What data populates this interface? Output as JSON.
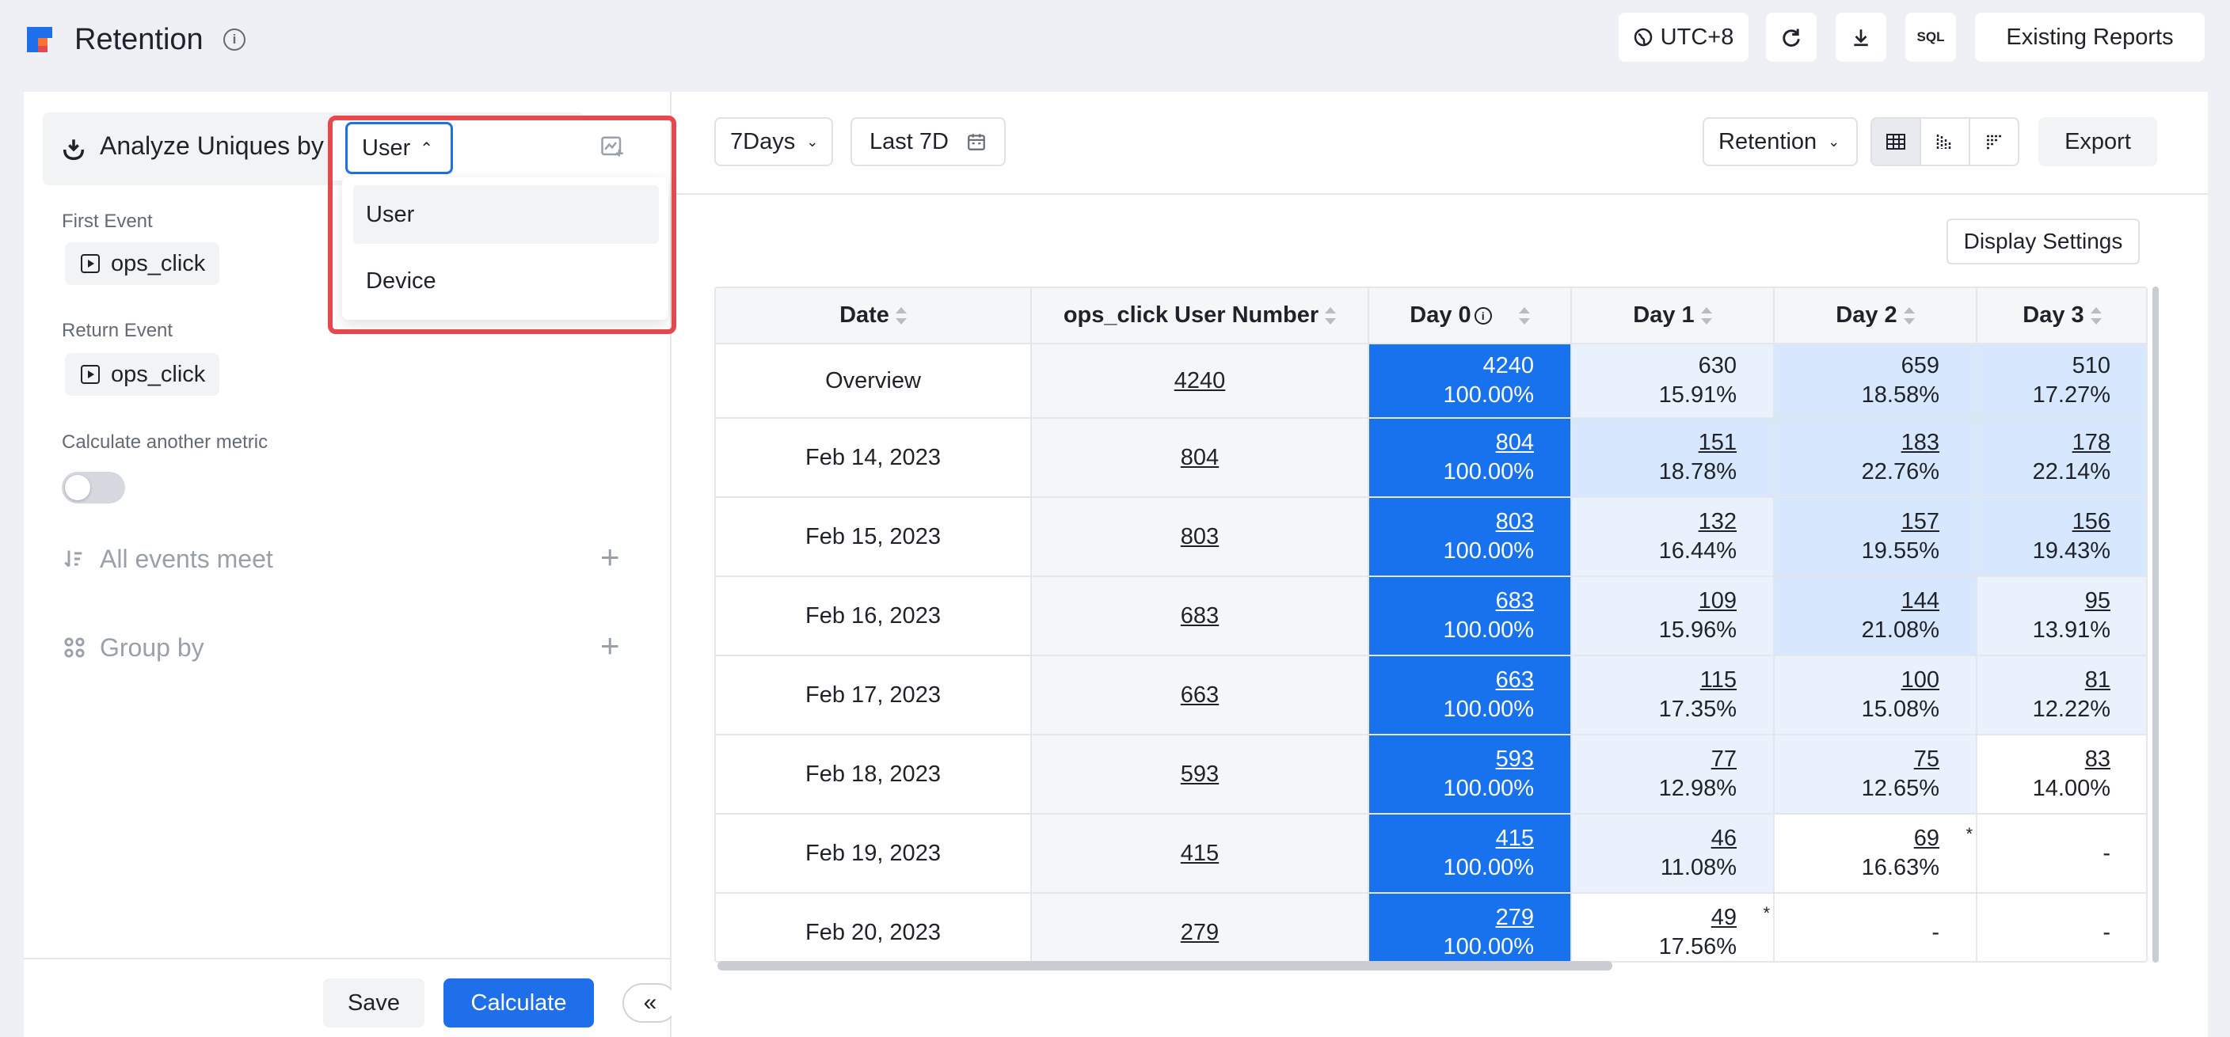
{
  "header": {
    "title": "Retention",
    "timezone": "UTC+8",
    "sql_label": "SQL",
    "existing_reports": "Existing Reports"
  },
  "left": {
    "analyze_label": "Analyze Uniques by",
    "selected_unit": "User",
    "unit_options": [
      "User",
      "Device"
    ],
    "first_event_label": "First Event",
    "first_event": "ops_click",
    "return_event_label": "Return Event",
    "return_event": "ops_click",
    "another_metric_label": "Calculate another metric",
    "another_metric_on": false,
    "all_events_label": "All events meet",
    "group_by_label": "Group by",
    "save": "Save",
    "calculate": "Calculate"
  },
  "toolbar": {
    "interval": "7Days",
    "range": "Last 7D",
    "metric": "Retention",
    "export": "Export",
    "display_settings": "Display Settings"
  },
  "table": {
    "headers": [
      "Date",
      "ops_click User Number",
      "Day 0",
      "Day 1",
      "Day 2",
      "Day 3"
    ],
    "rows": [
      {
        "date": "Overview",
        "num": "4240",
        "d0": [
          "4240",
          "100.00%"
        ],
        "d1": [
          "630",
          "15.91%"
        ],
        "d2": [
          "659",
          "18.58%"
        ],
        "d3": [
          "510",
          "17.27%"
        ]
      },
      {
        "date": "Feb 14, 2023",
        "num": "804",
        "d0": [
          "804",
          "100.00%"
        ],
        "d1": [
          "151",
          "18.78%"
        ],
        "d2": [
          "183",
          "22.76%"
        ],
        "d3": [
          "178",
          "22.14%"
        ]
      },
      {
        "date": "Feb 15, 2023",
        "num": "803",
        "d0": [
          "803",
          "100.00%"
        ],
        "d1": [
          "132",
          "16.44%"
        ],
        "d2": [
          "157",
          "19.55%"
        ],
        "d3": [
          "156",
          "19.43%"
        ]
      },
      {
        "date": "Feb 16, 2023",
        "num": "683",
        "d0": [
          "683",
          "100.00%"
        ],
        "d1": [
          "109",
          "15.96%"
        ],
        "d2": [
          "144",
          "21.08%"
        ],
        "d3": [
          "95",
          "13.91%"
        ]
      },
      {
        "date": "Feb 17, 2023",
        "num": "663",
        "d0": [
          "663",
          "100.00%"
        ],
        "d1": [
          "115",
          "17.35%"
        ],
        "d2": [
          "100",
          "15.08%"
        ],
        "d3": [
          "81",
          "12.22%"
        ]
      },
      {
        "date": "Feb 18, 2023",
        "num": "593",
        "d0": [
          "593",
          "100.00%"
        ],
        "d1": [
          "77",
          "12.98%"
        ],
        "d2": [
          "75",
          "12.65%"
        ],
        "d3": [
          "83",
          "14.00%"
        ]
      },
      {
        "date": "Feb 19, 2023",
        "num": "415",
        "d0": [
          "415",
          "100.00%"
        ],
        "d1": [
          "46",
          "11.08%"
        ],
        "d2": [
          "69",
          "16.63%"
        ],
        "d3": [
          "-"
        ]
      },
      {
        "date": "Feb 20, 2023",
        "num": "279",
        "d0": [
          "279",
          "100.00%"
        ],
        "d1": [
          "49",
          "17.56%"
        ],
        "d2": [
          "-"
        ],
        "d3": [
          "-"
        ]
      }
    ],
    "partial_marker": "*"
  },
  "colors": {
    "accent": "#1f6feb",
    "day0": "#1872ee",
    "heat_low": "#e9f1fd",
    "heat_high": "#d7e7fd",
    "highlight_box": "#e5484d"
  }
}
